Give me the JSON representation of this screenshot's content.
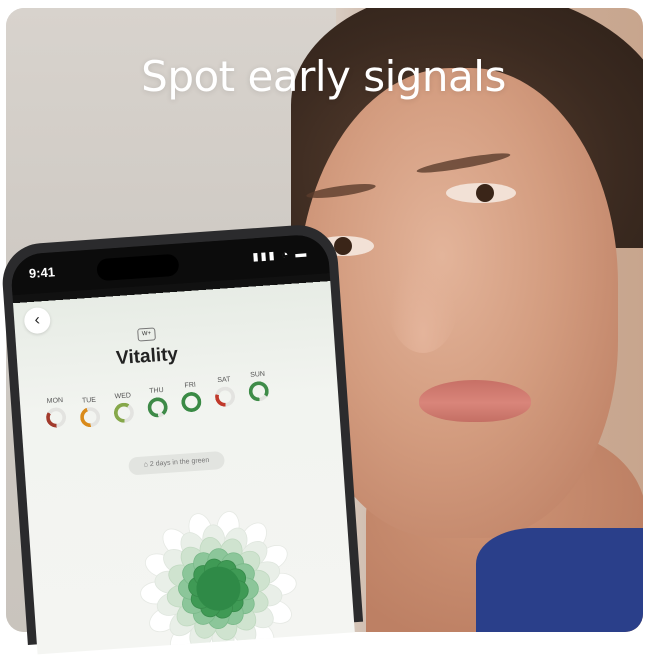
{
  "headline": "Spot early signals",
  "phone": {
    "status_time": "9:41",
    "status_icons": "▮▮▮ ◔ ▬",
    "back_glyph": "‹",
    "badge": "W+",
    "title": "Vitality",
    "days": [
      {
        "label": "MON",
        "color": "#a23a2c",
        "fill": 0.35
      },
      {
        "label": "TUE",
        "color": "#d98a1a",
        "fill": 0.45
      },
      {
        "label": "WED",
        "color": "#86a84a",
        "fill": 0.6
      },
      {
        "label": "THU",
        "color": "#3e8a48",
        "fill": 0.9
      },
      {
        "label": "FRI",
        "color": "#3a8a45",
        "fill": 1.0
      },
      {
        "label": "SAT",
        "color": "#c0392b",
        "fill": 0.3
      },
      {
        "label": "SUN",
        "color": "#3f8c49",
        "fill": 0.85
      }
    ],
    "pill_text": "2 days in the green",
    "accent": "#3f9a55"
  }
}
